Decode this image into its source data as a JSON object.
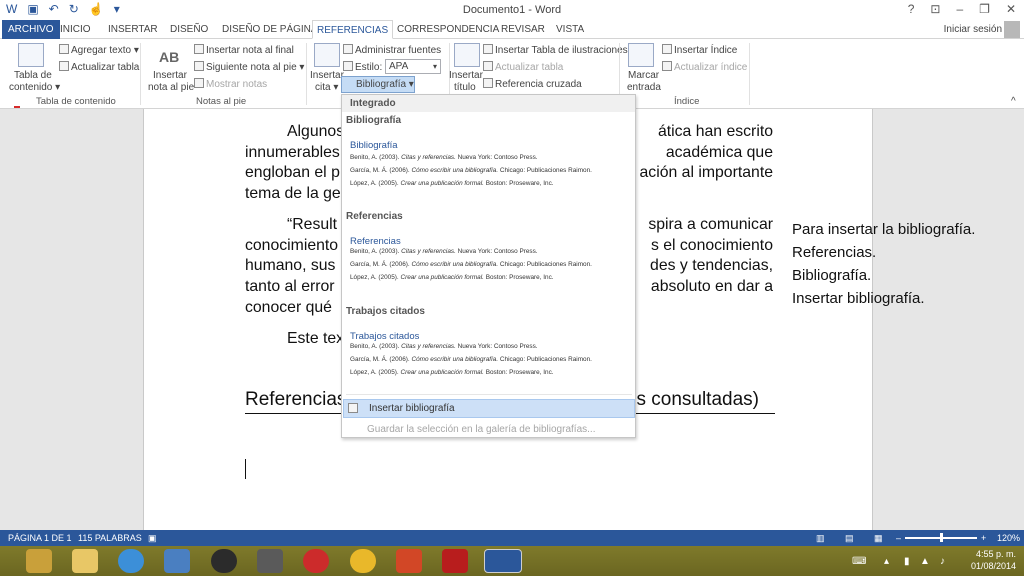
{
  "window": {
    "title": "Documento1 - Word",
    "controls": [
      "?",
      "⊡",
      "–",
      "❐",
      "✕"
    ]
  },
  "tabs": [
    "ARCHIVO",
    "INICIO",
    "INSERTAR",
    "DISEÑO",
    "DISEÑO DE PÁGINA",
    "REFERENCIAS",
    "CORRESPONDENCIA",
    "REVISAR",
    "VISTA"
  ],
  "active_tab": "REFERENCIAS",
  "signin": "Iniciar sesión",
  "ribbon": {
    "toc": {
      "line1": "Tabla de",
      "line2": "contenido ▾",
      "add_text": "Agregar texto ▾",
      "update": "Actualizar tabla",
      "group": "Tabla de contenido"
    },
    "footnotes": {
      "insert_line1": "Insertar",
      "insert_line2": "nota al pie",
      "endnote": "Insertar nota al final",
      "next": "Siguiente nota al pie ▾",
      "show": "Mostrar notas",
      "group": "Notas al pie",
      "ab_icon": "AB"
    },
    "citations": {
      "insert_line1": "Insertar",
      "insert_line2": "cita ▾",
      "manage": "Administrar fuentes",
      "style_label": "Estilo:",
      "style_value": "APA",
      "bibliography": "Bibliografía ▾"
    },
    "captions": {
      "insert_line1": "Insertar",
      "insert_line2": "título",
      "insert_table": "Insertar Tabla de ilustraciones",
      "update": "Actualizar tabla",
      "cross": "Referencia cruzada"
    },
    "index": {
      "mark_line1": "Marcar",
      "mark_line2": "entrada",
      "insert": "Insertar Índice",
      "update": "Actualizar índice",
      "group": "Índice"
    }
  },
  "document": {
    "p1": "Algunos autores que se ocupan de esta temática han escrito innumerables libros relacionados con la producción académica que engloban el problema general de la normalización al importante tema de la gestión.",
    "p1_lines": [
      "Algunos",
      "innumerables",
      "engloban el p",
      "tema de la ge"
    ],
    "p1_right": [
      "ática   han   escrito",
      "académica   que",
      "ación al importante",
      ""
    ],
    "p2_lines": [
      "“Result",
      "conocimiento",
      "humano,  sus",
      "tanto al error",
      "conocer qué"
    ],
    "p2_right": [
      "spira  a  comunicar",
      "s  el  conocimiento",
      "des  y  tendencias,",
      "absoluto en dar a",
      ""
    ],
    "p3": "Este tex",
    "ref_heading_left": "Referencias",
    "ref_heading_right": "s consultadas)"
  },
  "side_note": [
    "Para insertar la bibliografía.",
    "Referencias.",
    "Bibliografía.",
    "Insertar bibliografía."
  ],
  "dropdown": {
    "section": "Integrado",
    "groups": [
      {
        "category": "Bibliografía",
        "title": "Bibliografía",
        "entries": [
          {
            "a": "Benito, A. (2003). ",
            "t": "Citas y referencias.",
            "b": " Nueva York: Contoso Press."
          },
          {
            "a": "García, M. Á. (2006). ",
            "t": "Cómo escribir una bibliografía.",
            "b": " Chicago: Publicaciones Raimon."
          },
          {
            "a": "López, A. (2005). ",
            "t": "Crear una publicación formal.",
            "b": " Boston: Proseware, Inc."
          }
        ]
      },
      {
        "category": "Referencias",
        "title": "Referencias",
        "entries": [
          {
            "a": "Benito, A. (2003). ",
            "t": "Citas y referencias.",
            "b": " Nueva York: Contoso Press."
          },
          {
            "a": "García, M. Á. (2006). ",
            "t": "Cómo escribir una bibliografía.",
            "b": " Chicago: Publicaciones Raimon."
          },
          {
            "a": "López, A. (2005). ",
            "t": "Crear una publicación formal.",
            "b": " Boston: Proseware, Inc."
          }
        ]
      },
      {
        "category": "Trabajos citados",
        "title": "Trabajos citados",
        "entries": [
          {
            "a": "Benito, A. (2003). ",
            "t": "Citas y referencias.",
            "b": " Nueva York: Contoso Press."
          },
          {
            "a": "García, M. Á. (2006). ",
            "t": "Cómo escribir una bibliografía.",
            "b": " Chicago: Publicaciones Raimon."
          },
          {
            "a": "López, A. (2005). ",
            "t": "Crear una publicación formal.",
            "b": " Boston: Proseware, Inc."
          }
        ]
      }
    ],
    "insert": "Insertar bibliografía",
    "save": "Guardar la selección en la galería de bibliografías..."
  },
  "status": {
    "page": "PÁGINA 1 DE 1",
    "words": "115 PALABRAS",
    "zoom": "120%",
    "zoom_minus": "–",
    "zoom_plus": "+"
  },
  "taskbar": {
    "time": "4:55 p. m.",
    "date": "01/08/2014",
    "apps": [
      "app-icon",
      "folder-icon",
      "ie-icon",
      "media-icon",
      "screen-icon",
      "power-icon",
      "chrome-icon",
      "powerpoint-icon",
      "acrobat-icon",
      "word-icon"
    ]
  },
  "colors": {
    "word_blue": "#2b579a",
    "taskbar": "#7a7427",
    "highlight": "#cde0f7"
  }
}
